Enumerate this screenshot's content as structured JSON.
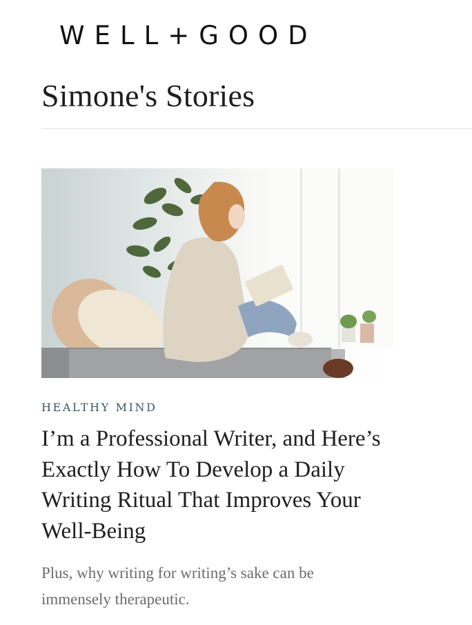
{
  "site": {
    "logo_text": "WELL+GOOD"
  },
  "page": {
    "title": "Simone's Stories"
  },
  "article": {
    "category": "HEALTHY MIND",
    "headline": "I’m a Professional Writer, and Here’s Exactly How To Develop a Daily Writing Ritual That Improves Your Well-Being",
    "dek": "Plus, why writing for writing’s sake can be immensely therapeutic."
  }
}
